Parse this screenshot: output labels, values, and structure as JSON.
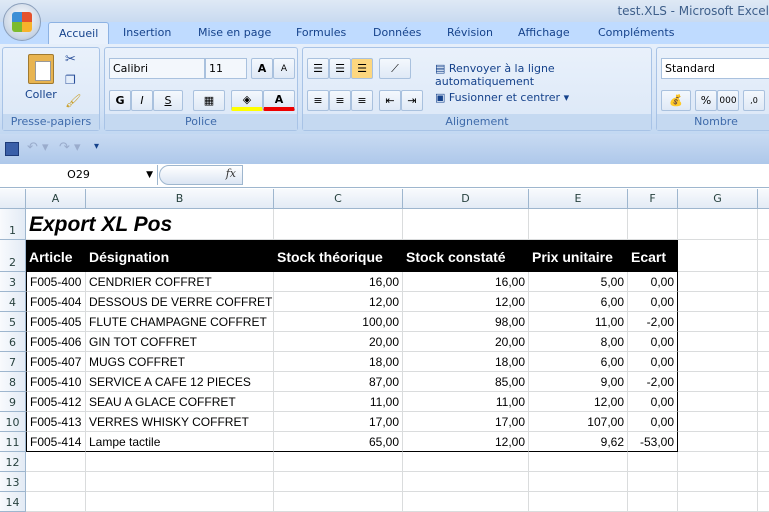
{
  "window": {
    "title": "test.XLS - Microsoft Excel"
  },
  "tabs": [
    "Accueil",
    "Insertion",
    "Mise en page",
    "Formules",
    "Données",
    "Révision",
    "Affichage",
    "Compléments"
  ],
  "ribbon": {
    "clipboard": {
      "paste": "Coller",
      "label": "Presse-papiers"
    },
    "font": {
      "name": "Calibri",
      "size": "11",
      "bold": "G",
      "italic": "I",
      "underline": "S",
      "label": "Police"
    },
    "alignment": {
      "wrap": "Renvoyer à la ligne automatiquement",
      "merge": "Fusionner et centrer",
      "label": "Alignement"
    },
    "number": {
      "format": "Standard",
      "percent": "%",
      "thousands": "000",
      "label": "Nombre"
    }
  },
  "formula_bar": {
    "name_box": "O29",
    "fx": "fx",
    "value": ""
  },
  "columns": [
    "A",
    "B",
    "C",
    "D",
    "E",
    "F",
    "G"
  ],
  "rows": [
    "1",
    "2",
    "3",
    "4",
    "5",
    "6",
    "7",
    "8",
    "9",
    "10",
    "11",
    "12",
    "13",
    "14"
  ],
  "sheet": {
    "title": "Export XL Pos",
    "headers": [
      "Article",
      "Désignation",
      "Stock théorique",
      "Stock constaté",
      "Prix unitaire",
      "Ecart"
    ],
    "data": [
      [
        "F005-400",
        "CENDRIER COFFRET",
        "16,00",
        "16,00",
        "5,00",
        "0,00"
      ],
      [
        "F005-404",
        "DESSOUS DE VERRE COFFRET",
        "12,00",
        "12,00",
        "6,00",
        "0,00"
      ],
      [
        "F005-405",
        "FLUTE CHAMPAGNE COFFRET",
        "100,00",
        "98,00",
        "11,00",
        "-2,00"
      ],
      [
        "F005-406",
        "GIN TOT COFFRET",
        "20,00",
        "20,00",
        "8,00",
        "0,00"
      ],
      [
        "F005-407",
        "MUGS COFFRET",
        "18,00",
        "18,00",
        "6,00",
        "0,00"
      ],
      [
        "F005-410",
        "SERVICE A CAFE 12 PIECES",
        "87,00",
        "85,00",
        "9,00",
        "-2,00"
      ],
      [
        "F005-412",
        "SEAU A GLACE COFFRET",
        "11,00",
        "11,00",
        "12,00",
        "0,00"
      ],
      [
        "F005-413",
        "VERRES WHISKY COFFRET",
        "17,00",
        "17,00",
        "107,00",
        "0,00"
      ],
      [
        "F005-414",
        "Lampe tactile",
        "65,00",
        "12,00",
        "9,62",
        "-53,00"
      ]
    ]
  }
}
